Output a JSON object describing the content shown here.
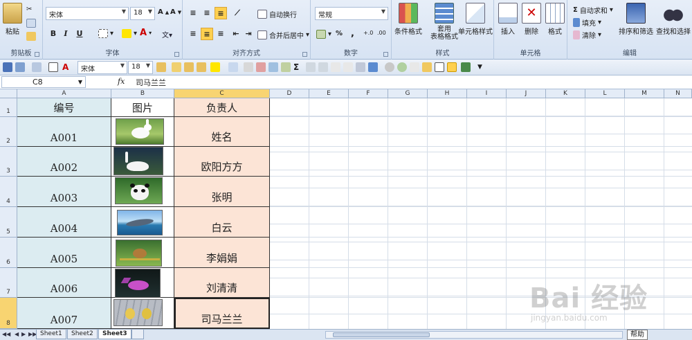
{
  "ribbon": {
    "clipboard": {
      "paste": "粘贴",
      "group": "剪贴板"
    },
    "font": {
      "family": "宋体",
      "size": "18",
      "bold": "B",
      "italic": "I",
      "underline": "U",
      "group": "字体"
    },
    "alignment": {
      "wrap": "自动换行",
      "merge": "合并后居中",
      "group": "对齐方式"
    },
    "number": {
      "format": "常规",
      "percent": "%",
      "comma": ",",
      "group": "数字"
    },
    "styles": {
      "conditional": "条件格式",
      "table": "套用\n表格格式",
      "cell": "单元格样式",
      "group": "样式"
    },
    "cells": {
      "insert": "插入",
      "delete": "删除",
      "format": "格式",
      "group": "单元格"
    },
    "editing": {
      "autosum": "自动求和",
      "fill": "填充",
      "clear": "清除",
      "sort": "排序和筛选",
      "find": "查找和选择",
      "group": "编辑"
    }
  },
  "toolbar2": {
    "font": "宋体",
    "size": "18",
    "sigma": "Σ"
  },
  "formula_bar": {
    "name_box": "C8",
    "fx": "fx",
    "content": "司马兰兰"
  },
  "columns": [
    "A",
    "B",
    "C",
    "D",
    "E",
    "F",
    "G",
    "H",
    "I",
    "J",
    "K",
    "L",
    "M",
    "N"
  ],
  "rows": [
    "1",
    "2",
    "3",
    "4",
    "5",
    "6",
    "7",
    "8"
  ],
  "table": {
    "headers": [
      "编号",
      "图片",
      "负责人"
    ],
    "rows": [
      {
        "id": "A001",
        "name": "姓名",
        "picture": "rabbit"
      },
      {
        "id": "A002",
        "name": "欧阳方方",
        "picture": "swan"
      },
      {
        "id": "A003",
        "name": "张明",
        "picture": "panda"
      },
      {
        "id": "A004",
        "name": "白云",
        "picture": "dolphin"
      },
      {
        "id": "A005",
        "name": "李娟娟",
        "picture": "chipmunk"
      },
      {
        "id": "A006",
        "name": "刘清清",
        "picture": "fish"
      },
      {
        "id": "A007",
        "name": "司马兰兰",
        "picture": "ducklings"
      }
    ]
  },
  "sheets": [
    "Sheet1",
    "Sheet2",
    "Sheet3"
  ],
  "active_sheet": "Sheet3",
  "help": "帮助",
  "watermark": {
    "main": "Bai 经验",
    "sub": "jingyan.baidu.com"
  },
  "colors": {
    "col_a": "#dcecf1",
    "col_c": "#fce4d6",
    "active_header": "#f8d471"
  }
}
